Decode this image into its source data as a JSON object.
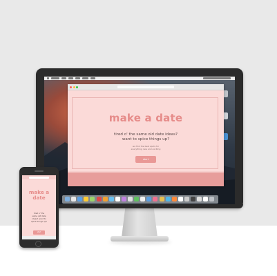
{
  "desktop": {
    "drives": [
      {
        "label": "",
        "color": "#bfc3c8"
      },
      {
        "label": "",
        "color": "#cfd3d8"
      },
      {
        "label": "",
        "color": "#4a8fd0"
      }
    ],
    "dock_colors": [
      "#7fb0e0",
      "#e8e8e8",
      "#5aa0e6",
      "#ffcc33",
      "#9cd36a",
      "#e04848",
      "#f0a030",
      "#6ac0f0",
      "#ffffff",
      "#c080e0",
      "#e0e0e0",
      "#60c060",
      "#f0f0f0",
      "#5a9ee0",
      "#f07090",
      "#e8c050",
      "#50b8e8",
      "#ff8a3a",
      "#ffffff",
      "#cccccc",
      "#444444",
      "#e0e0e0",
      "#ffffff",
      "#bfc3c8"
    ]
  },
  "site": {
    "title": "make a date",
    "question_line1": "tired o' the same old date ideas?",
    "question_line2": "want to spice things up?",
    "sub_line1": "we find the best spots for",
    "sub_line2": "everything new and exciting",
    "button_label": "start"
  },
  "mobile_site": {
    "title_line1": "make a",
    "title_line2": "date",
    "lines": [
      "tired o' the",
      "same old date",
      "ideas? want to",
      "spice things up?"
    ],
    "button_label": "start"
  },
  "colors": {
    "brand": "#e68c8a",
    "page_bg": "#fbdad8",
    "footer_band": "#e79d9b"
  }
}
